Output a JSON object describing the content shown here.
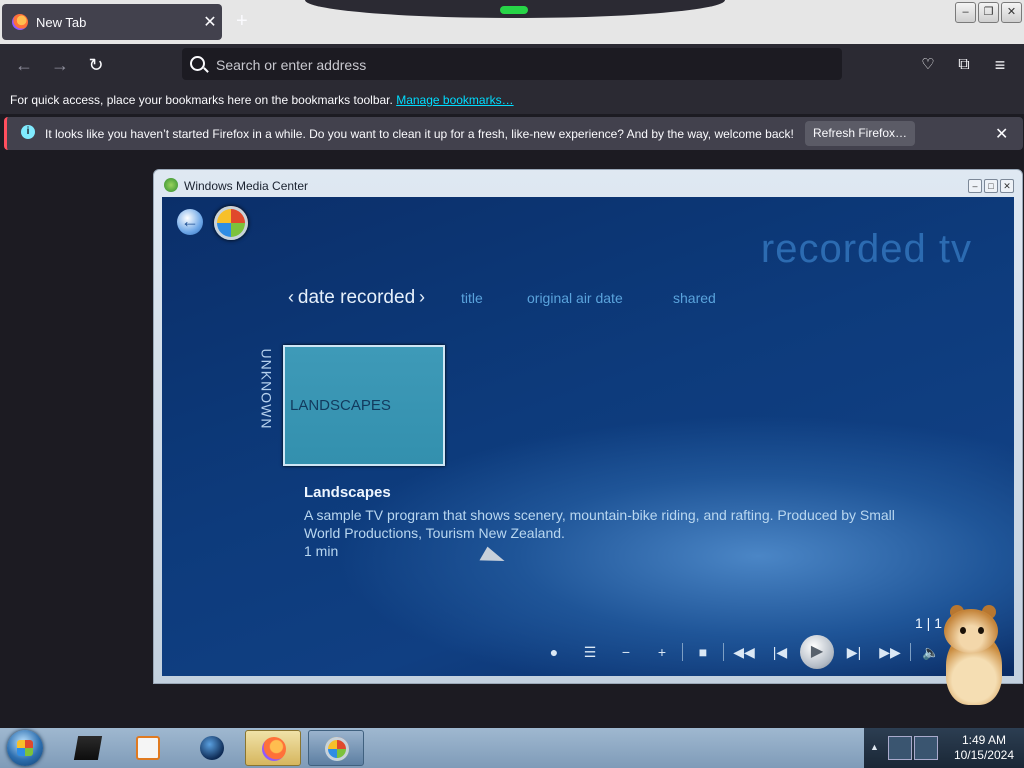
{
  "browser": {
    "tab_title": "New Tab",
    "tab_close": "✕",
    "new_tab": "+",
    "url_placeholder": "Search or enter address",
    "bookmarks_text": "For quick access, place your bookmarks here on the bookmarks toolbar.",
    "bookmarks_link": "Manage bookmarks…",
    "notice_text": "It looks like you haven’t started Firefox in a while. Do you want to clean it up for a fresh, like-new experience? And by the way, welcome back!",
    "notice_button": "Refresh Firefox…",
    "notice_close": "✕",
    "nav_icons": [
      "back-arrow-icon",
      "forward-arrow-icon",
      "reload-icon",
      "pocket-icon",
      "extensions-icon",
      "menu-icon"
    ]
  },
  "wmc": {
    "window_title": "Windows Media Center",
    "heading": "recorded tv",
    "filters": {
      "selected": "date recorded",
      "others": [
        "title",
        "original air date",
        "shared"
      ]
    },
    "group_label": "UNKNOWN",
    "tile_label": "LANDSCAPES",
    "details": {
      "name": "Landscapes",
      "description": "A sample TV program that shows scenery, mountain-bike riding, and rafting. Produced by Small World Productions, Tourism New Zealand.",
      "duration": "1 min"
    },
    "pager": "1 | 1",
    "transport_icons": [
      "record-icon",
      "list-icon",
      "minus-icon",
      "plus-icon",
      "stop-icon",
      "rewind-icon",
      "previous-icon",
      "play-icon",
      "next-icon",
      "fast-forward-icon",
      "volume-icon"
    ]
  },
  "taskbar": {
    "time": "1:49 AM",
    "date": "10/15/2024",
    "apps": [
      "explorer",
      "media-player",
      "browser-globe",
      "firefox",
      "media-center"
    ]
  },
  "colors": {
    "accent_link": "#00ddff",
    "notice_border": "#ff4f5e",
    "wmc_heading": "#2c6bb1",
    "wmc_filter": "#5aa3dc"
  }
}
